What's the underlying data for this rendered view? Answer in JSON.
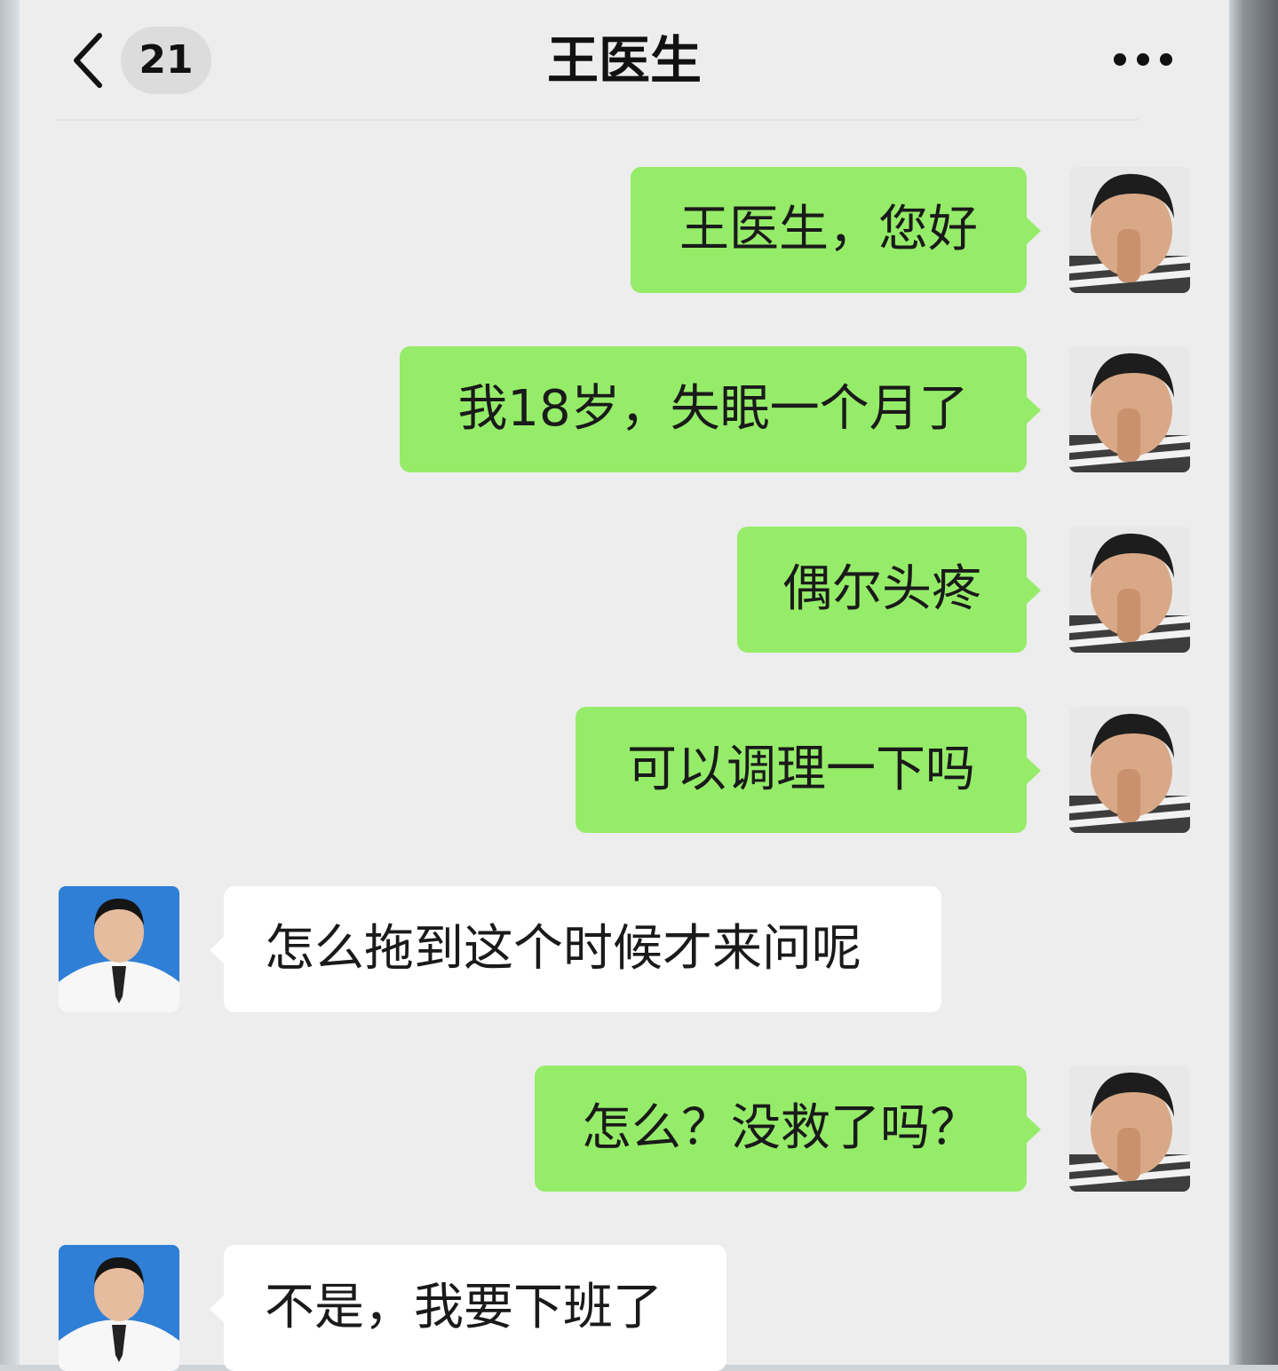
{
  "header": {
    "back_icon": "chevron-left-icon",
    "unread_count": "21",
    "title": "王医生",
    "more_icon": "more-dots-icon"
  },
  "messages": [
    {
      "side": "sent",
      "text": "王医生，您好",
      "avatar": "child-avatar"
    },
    {
      "side": "sent",
      "text": "我18岁，失眠一个月了",
      "avatar": "child-avatar"
    },
    {
      "side": "sent",
      "text": "偶尔头疼",
      "avatar": "child-avatar"
    },
    {
      "side": "sent",
      "text": "可以调理一下吗",
      "avatar": "child-avatar"
    },
    {
      "side": "received",
      "text": "怎么拖到这个时候才来问呢",
      "avatar": "doctor-avatar"
    },
    {
      "side": "sent",
      "text": "怎么？没救了吗？",
      "avatar": "child-avatar"
    },
    {
      "side": "received",
      "text": "不是，我要下班了",
      "avatar": "doctor-avatar"
    }
  ],
  "colors": {
    "sent_bubble": "#95ec69",
    "received_bubble": "#ffffff",
    "background": "#ededed"
  }
}
